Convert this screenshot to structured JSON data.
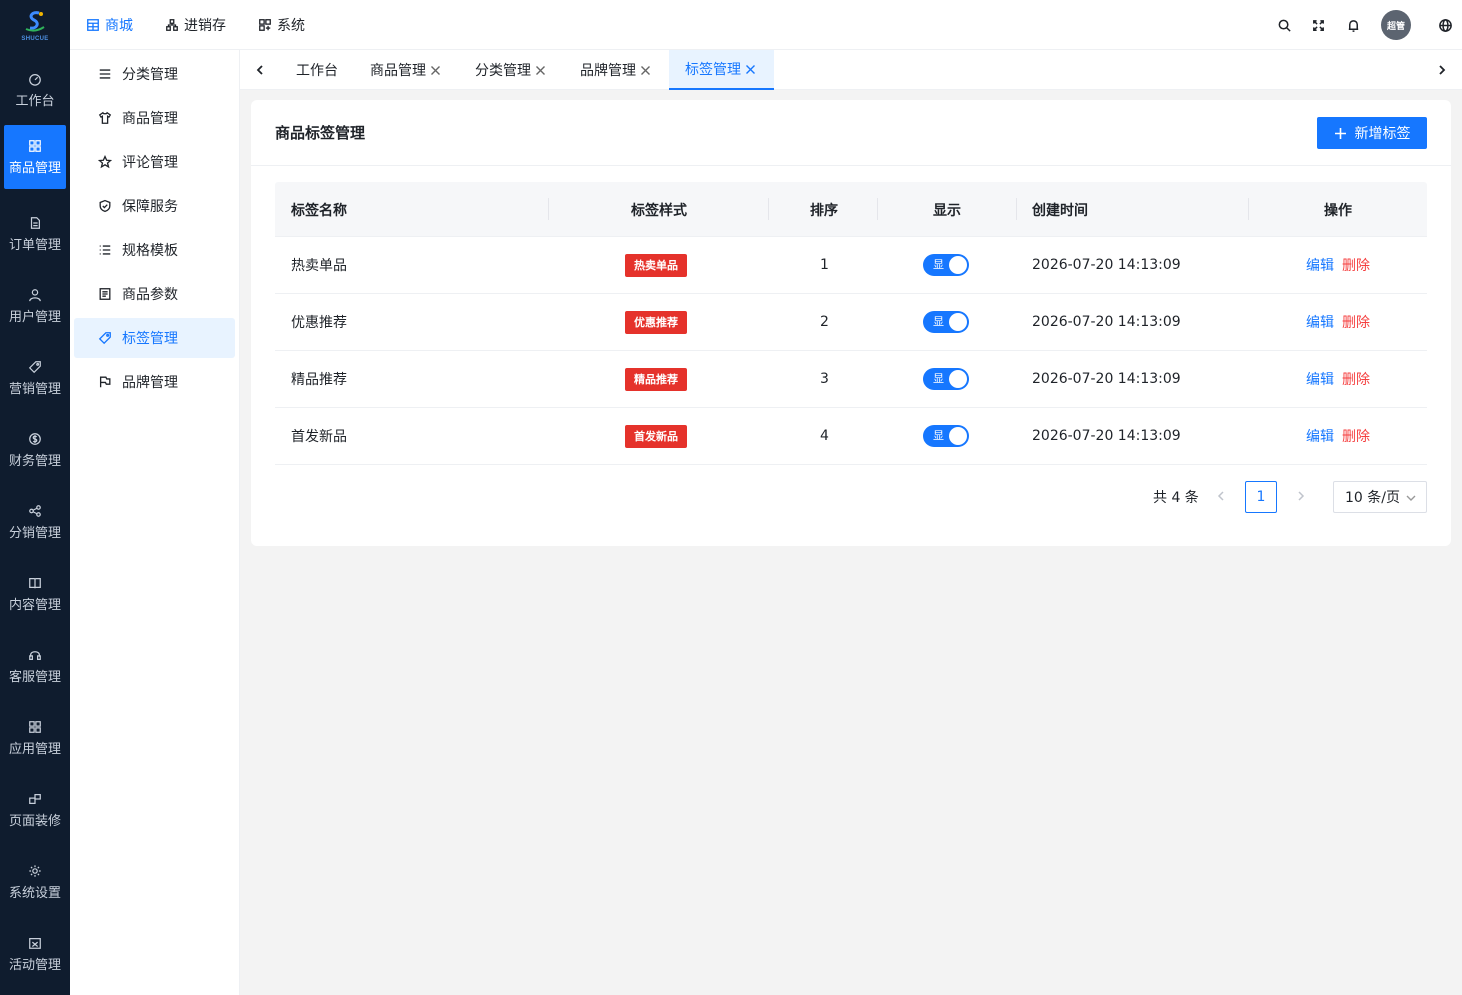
{
  "logo": {
    "text": "SHUCUE"
  },
  "rail": {
    "items": [
      {
        "label": "工作台",
        "icon": "dashboard-icon"
      },
      {
        "label": "商品管理",
        "icon": "grid-icon"
      },
      {
        "label": "订单管理",
        "icon": "document-icon"
      },
      {
        "label": "用户管理",
        "icon": "user-icon"
      },
      {
        "label": "营销管理",
        "icon": "tag-icon"
      },
      {
        "label": "财务管理",
        "icon": "dollar-icon"
      },
      {
        "label": "分销管理",
        "icon": "share-icon"
      },
      {
        "label": "内容管理",
        "icon": "book-icon"
      },
      {
        "label": "客服管理",
        "icon": "headset-icon"
      },
      {
        "label": "应用管理",
        "icon": "apps-icon"
      },
      {
        "label": "页面装修",
        "icon": "layout-icon"
      },
      {
        "label": "系统设置",
        "icon": "gear-icon"
      },
      {
        "label": "活动管理",
        "icon": "calendar-icon"
      }
    ],
    "active_index": 1
  },
  "topnav": {
    "items": [
      {
        "label": "商城",
        "icon": "store-icon"
      },
      {
        "label": "进销存",
        "icon": "sitemap-icon"
      },
      {
        "label": "系统",
        "icon": "system-icon"
      }
    ],
    "active_index": 0,
    "avatar_text": "超管"
  },
  "submenu": {
    "items": [
      {
        "label": "分类管理",
        "icon": "list-icon"
      },
      {
        "label": "商品管理",
        "icon": "shirt-icon"
      },
      {
        "label": "评论管理",
        "icon": "star-icon"
      },
      {
        "label": "保障服务",
        "icon": "shield-icon"
      },
      {
        "label": "规格模板",
        "icon": "bullet-list-icon"
      },
      {
        "label": "商品参数",
        "icon": "form-icon"
      },
      {
        "label": "标签管理",
        "icon": "tag-icon"
      },
      {
        "label": "品牌管理",
        "icon": "flag-icon"
      }
    ],
    "active_index": 6
  },
  "tabs": {
    "items": [
      {
        "label": "工作台",
        "closable": false
      },
      {
        "label": "商品管理",
        "closable": true
      },
      {
        "label": "分类管理",
        "closable": true
      },
      {
        "label": "品牌管理",
        "closable": true
      },
      {
        "label": "标签管理",
        "closable": true
      }
    ],
    "active_index": 4
  },
  "page": {
    "title": "商品标签管理",
    "add_button": "新增标签"
  },
  "table": {
    "columns": [
      "标签名称",
      "标签样式",
      "排序",
      "显示",
      "创建时间",
      "操作"
    ],
    "rows": [
      {
        "name": "热卖单品",
        "style": "热卖单品",
        "sort": "1",
        "show": "显",
        "created": "2026-07-20 14:13:09"
      },
      {
        "name": "优惠推荐",
        "style": "优惠推荐",
        "sort": "2",
        "show": "显",
        "created": "2026-07-20 14:13:09"
      },
      {
        "name": "精品推荐",
        "style": "精品推荐",
        "sort": "3",
        "show": "显",
        "created": "2026-07-20 14:13:09"
      },
      {
        "name": "首发新品",
        "style": "首发新品",
        "sort": "4",
        "show": "显",
        "created": "2026-07-20 14:13:09"
      }
    ],
    "edit_label": "编辑",
    "delete_label": "删除"
  },
  "pagination": {
    "total_text": "共 4 条",
    "current_page": "1",
    "page_size": "10 条/页"
  },
  "colors": {
    "primary": "#1677ff",
    "danger": "#f53f3f",
    "tag_red": "#e5322b",
    "rail_bg": "#0f1c2e"
  }
}
